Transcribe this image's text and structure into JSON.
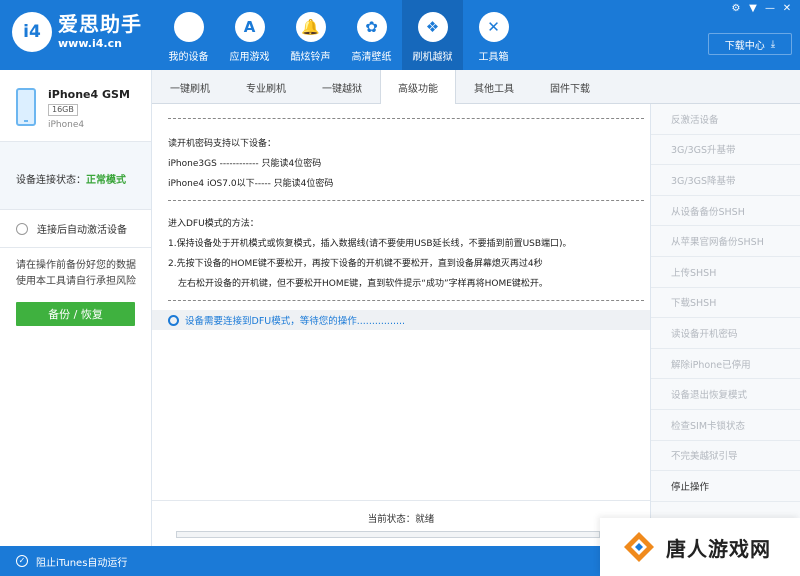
{
  "header": {
    "logo_mark": "i4",
    "logo_name": "爱思助手",
    "logo_url": "www.i4.cn",
    "nav": [
      {
        "label": "我的设备",
        "icon": "apple-icon",
        "glyph": ""
      },
      {
        "label": "应用游戏",
        "icon": "app-store-icon",
        "glyph": "A"
      },
      {
        "label": "酷炫铃声",
        "icon": "bell-icon",
        "glyph": "🔔"
      },
      {
        "label": "高清壁纸",
        "icon": "flower-icon",
        "glyph": "✿"
      },
      {
        "label": "刷机越狱",
        "icon": "dropbox-icon",
        "glyph": "❖"
      },
      {
        "label": "工具箱",
        "icon": "tools-icon",
        "glyph": "✕"
      }
    ],
    "download_label": "下载中心",
    "download_icon": "download-icon"
  },
  "device": {
    "name": "iPhone4 GSM",
    "capacity": "16GB",
    "model": "iPhone4",
    "status_label": "设备连接状态：",
    "status_value": "正常模式",
    "auto_activate": "连接后自动激活设备",
    "warning_line1": "请在操作前备份好您的数据",
    "warning_line2": "使用本工具请自行承担风险",
    "backup_button": "备份 / 恢复"
  },
  "tabs": [
    "一键刷机",
    "专业刷机",
    "一键越狱",
    "高级功能",
    "其他工具",
    "固件下载"
  ],
  "active_tab": 3,
  "content": {
    "lines": [
      "读开机密码支持以下设备：",
      "iPhone3GS ------------ 只能读4位密码",
      "iPhone4 iOS7.0以下----- 只能读4位密码",
      "进入DFU模式的方法：",
      "1.保持设备处于开机模式或恢复模式，插入数据线(请不要使用USB延长线，不要插到前置USB端口)。",
      "2.先按下设备的HOME键不要松开，再按下设备的开机键不要松开，直到设备屏幕熄灭再过4秒",
      "左右松开设备的开机键，但不要松开HOME键，直到软件提示“成功”字样再将HOME键松开。"
    ],
    "notice": "设备需要连接到DFU模式，等待您的操作................"
  },
  "sidebar": {
    "items": [
      {
        "label": "反激活设备",
        "enabled": false
      },
      {
        "label": "3G/3GS升基带",
        "enabled": false
      },
      {
        "label": "3G/3GS降基带",
        "enabled": false
      },
      {
        "label": "从设备备份SHSH",
        "enabled": false
      },
      {
        "label": "从苹果官网备份SHSH",
        "enabled": false
      },
      {
        "label": "上传SHSH",
        "enabled": false
      },
      {
        "label": "下载SHSH",
        "enabled": false
      },
      {
        "label": "读设备开机密码",
        "enabled": false
      },
      {
        "label": "解除iPhone已停用",
        "enabled": false
      },
      {
        "label": "设备退出恢复模式",
        "enabled": false
      },
      {
        "label": "检查SIM卡锁状态",
        "enabled": false
      },
      {
        "label": "不完美越狱引导",
        "enabled": false
      },
      {
        "label": "停止操作",
        "enabled": true
      }
    ]
  },
  "status": {
    "label": "当前状态：就绪",
    "progress": 0
  },
  "footer": {
    "itunes_label": "阻止iTunes自动运行"
  },
  "watermark": {
    "text": "唐人游戏网"
  },
  "colors": {
    "brand_blue": "#1b7ad7",
    "green": "#3fb13f",
    "disabled_text": "#b3b8bf"
  }
}
